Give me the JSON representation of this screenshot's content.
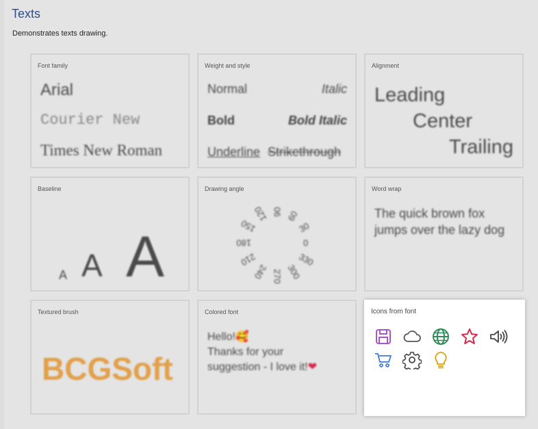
{
  "page": {
    "title": "Texts",
    "description": "Demonstrates texts drawing."
  },
  "cards": {
    "font_family": {
      "label": "Font family",
      "arial": "Arial",
      "courier": "Courier New",
      "times": "Times New Roman"
    },
    "weight_style": {
      "label": "Weight and style",
      "normal": "Normal",
      "italic": "Italic",
      "bold": "Bold",
      "bold_italic": "Bold Italic",
      "underline": "Underline",
      "strikethrough": "Strikethrough"
    },
    "alignment": {
      "label": "Alignment",
      "leading": "Leading",
      "center": "Center",
      "trailing": "Trailing"
    },
    "baseline": {
      "label": "Baseline",
      "small": "A",
      "medium": "A",
      "large": "A"
    },
    "drawing_angle": {
      "label": "Drawing angle",
      "angles": [
        "0",
        "30",
        "60",
        "90",
        "120",
        "150",
        "180",
        "210",
        "240",
        "270",
        "300",
        "330"
      ]
    },
    "word_wrap": {
      "label": "Word wrap",
      "text": "The quick brown fox jumps over the lazy dog"
    },
    "textured_brush": {
      "label": "Textured brush",
      "text": "BCGSoft"
    },
    "colored_font": {
      "label": "Colored font",
      "line1": "Hello!",
      "emoji1": "🥰",
      "line2": "Thanks for your",
      "line3": "suggestion - I love it!",
      "emoji2": "❤"
    },
    "icons_font": {
      "label": "Icons from font"
    }
  },
  "icons": [
    {
      "name": "save-icon",
      "color": "#a855c8"
    },
    {
      "name": "cloud-icon",
      "color": "#555555"
    },
    {
      "name": "globe-icon",
      "color": "#2e8b57"
    },
    {
      "name": "star-icon",
      "color": "#d6284b"
    },
    {
      "name": "speaker-icon",
      "color": "#444444"
    },
    {
      "name": "cart-icon",
      "color": "#3a7bd5"
    },
    {
      "name": "gear-icon",
      "color": "#444444"
    },
    {
      "name": "lightbulb-icon",
      "color": "#e0a100"
    }
  ]
}
